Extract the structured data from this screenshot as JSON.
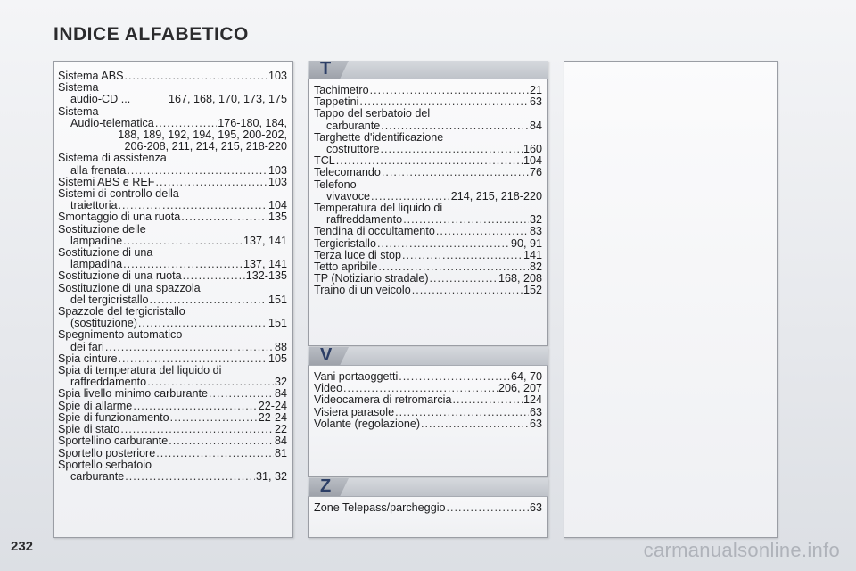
{
  "title": "INDICE ALFABETICO",
  "page_number": "232",
  "watermark": "carmanualsonline.info",
  "col1": [
    {
      "lines": [
        {
          "t": "Sistema ABS",
          "p": "103"
        }
      ]
    },
    {
      "lines": [
        {
          "t": "Sistema"
        },
        {
          "t": "audio-CD ...",
          "p": "167, 168, 170, 173, 175",
          "cont": true,
          "nodots": true
        }
      ]
    },
    {
      "lines": [
        {
          "t": "Sistema"
        },
        {
          "t": "Audio-telematica",
          "p": "176-180, 184,",
          "cont": true
        },
        {
          "t": "188, 189, 192, 194, 195, 200-202,",
          "right": true
        },
        {
          "t": "206-208, 211, 214, 215, 218-220",
          "right": true
        }
      ]
    },
    {
      "lines": [
        {
          "t": "Sistema di assistenza"
        },
        {
          "t": "alla frenata",
          "p": "103",
          "cont": true
        }
      ]
    },
    {
      "lines": [
        {
          "t": "Sistemi ABS e REF",
          "p": "103"
        }
      ]
    },
    {
      "lines": [
        {
          "t": "Sistemi di controllo della"
        },
        {
          "t": "traiettoria",
          "p": "104",
          "cont": true
        }
      ]
    },
    {
      "lines": [
        {
          "t": "Smontaggio di una ruota",
          "p": "135"
        }
      ]
    },
    {
      "lines": [
        {
          "t": "Sostituzione delle"
        },
        {
          "t": "lampadine",
          "p": "137, 141",
          "cont": true
        }
      ]
    },
    {
      "lines": [
        {
          "t": "Sostituzione di una"
        },
        {
          "t": "lampadina",
          "p": "137, 141",
          "cont": true
        }
      ]
    },
    {
      "lines": [
        {
          "t": "Sostituzione di una ruota",
          "p": "132-135"
        }
      ]
    },
    {
      "lines": [
        {
          "t": "Sostituzione di una spazzola"
        },
        {
          "t": "del tergicristallo",
          "p": "151",
          "cont": true
        }
      ]
    },
    {
      "lines": [
        {
          "t": "Spazzole del tergicristallo"
        },
        {
          "t": "(sostituzione)",
          "p": "151",
          "cont": true
        }
      ]
    },
    {
      "lines": [
        {
          "t": "Spegnimento automatico"
        },
        {
          "t": "dei fari",
          "p": "88",
          "cont": true
        }
      ]
    },
    {
      "lines": [
        {
          "t": "Spia cinture",
          "p": "105"
        }
      ]
    },
    {
      "lines": [
        {
          "t": "Spia di temperatura del liquido di"
        },
        {
          "t": "raffreddamento",
          "p": "32",
          "cont": true
        }
      ]
    },
    {
      "lines": [
        {
          "t": "Spia livello minimo carburante",
          "p": "84"
        }
      ]
    },
    {
      "lines": [
        {
          "t": "Spie di allarme",
          "p": "22-24"
        }
      ]
    },
    {
      "lines": [
        {
          "t": "Spie di funzionamento",
          "p": "22-24"
        }
      ]
    },
    {
      "lines": [
        {
          "t": "Spie di stato",
          "p": "22"
        }
      ]
    },
    {
      "lines": [
        {
          "t": "Sportellino carburante",
          "p": "84"
        }
      ]
    },
    {
      "lines": [
        {
          "t": "Sportello posteriore",
          "p": "81"
        }
      ]
    },
    {
      "lines": [
        {
          "t": "Sportello serbatoio"
        },
        {
          "t": "carburante",
          "p": "31, 32",
          "cont": true
        }
      ]
    }
  ],
  "sections": [
    {
      "letter": "T",
      "entries": [
        {
          "lines": [
            {
              "t": "Tachimetro",
              "p": "21"
            }
          ]
        },
        {
          "lines": [
            {
              "t": "Tappetini",
              "p": "63"
            }
          ]
        },
        {
          "lines": [
            {
              "t": "Tappo del serbatoio del"
            },
            {
              "t": "carburante",
              "p": "84",
              "cont": true
            }
          ]
        },
        {
          "lines": [
            {
              "t": "Targhette d'identificazione"
            },
            {
              "t": "costruttore",
              "p": "160",
              "cont": true
            }
          ]
        },
        {
          "lines": [
            {
              "t": "TCL",
              "p": "104"
            }
          ]
        },
        {
          "lines": [
            {
              "t": "Telecomando",
              "p": "76"
            }
          ]
        },
        {
          "lines": [
            {
              "t": "Telefono"
            },
            {
              "t": "vivavoce",
              "p": "214, 215, 218-220",
              "cont": true
            }
          ]
        },
        {
          "lines": [
            {
              "t": "Temperatura del liquido di"
            },
            {
              "t": "raffreddamento",
              "p": "32",
              "cont": true
            }
          ]
        },
        {
          "lines": [
            {
              "t": "Tendina di occultamento",
              "p": "83"
            }
          ]
        },
        {
          "lines": [
            {
              "t": "Tergicristallo",
              "p": "90, 91"
            }
          ]
        },
        {
          "lines": [
            {
              "t": "Terza luce di stop",
              "p": "141"
            }
          ]
        },
        {
          "lines": [
            {
              "t": "Tetto apribile",
              "p": "82"
            }
          ]
        },
        {
          "lines": [
            {
              "t": "TP (Notiziario stradale)",
              "p": "168, 208"
            }
          ]
        },
        {
          "lines": [
            {
              "t": "Traino di un veicolo",
              "p": "152"
            }
          ]
        }
      ]
    },
    {
      "letter": "V",
      "entries": [
        {
          "lines": [
            {
              "t": "Vani portaoggetti",
              "p": "64, 70"
            }
          ]
        },
        {
          "lines": [
            {
              "t": "Video",
              "p": "206, 207"
            }
          ]
        },
        {
          "lines": [
            {
              "t": "Videocamera di retromarcia",
              "p": "124"
            }
          ]
        },
        {
          "lines": [
            {
              "t": "Visiera parasole",
              "p": "63"
            }
          ]
        },
        {
          "lines": [
            {
              "t": "Volante (regolazione)",
              "p": "63"
            }
          ]
        }
      ]
    },
    {
      "letter": "Z",
      "entries": [
        {
          "lines": [
            {
              "t": "Zone Telepass/parcheggio",
              "p": "63"
            }
          ]
        }
      ]
    }
  ]
}
